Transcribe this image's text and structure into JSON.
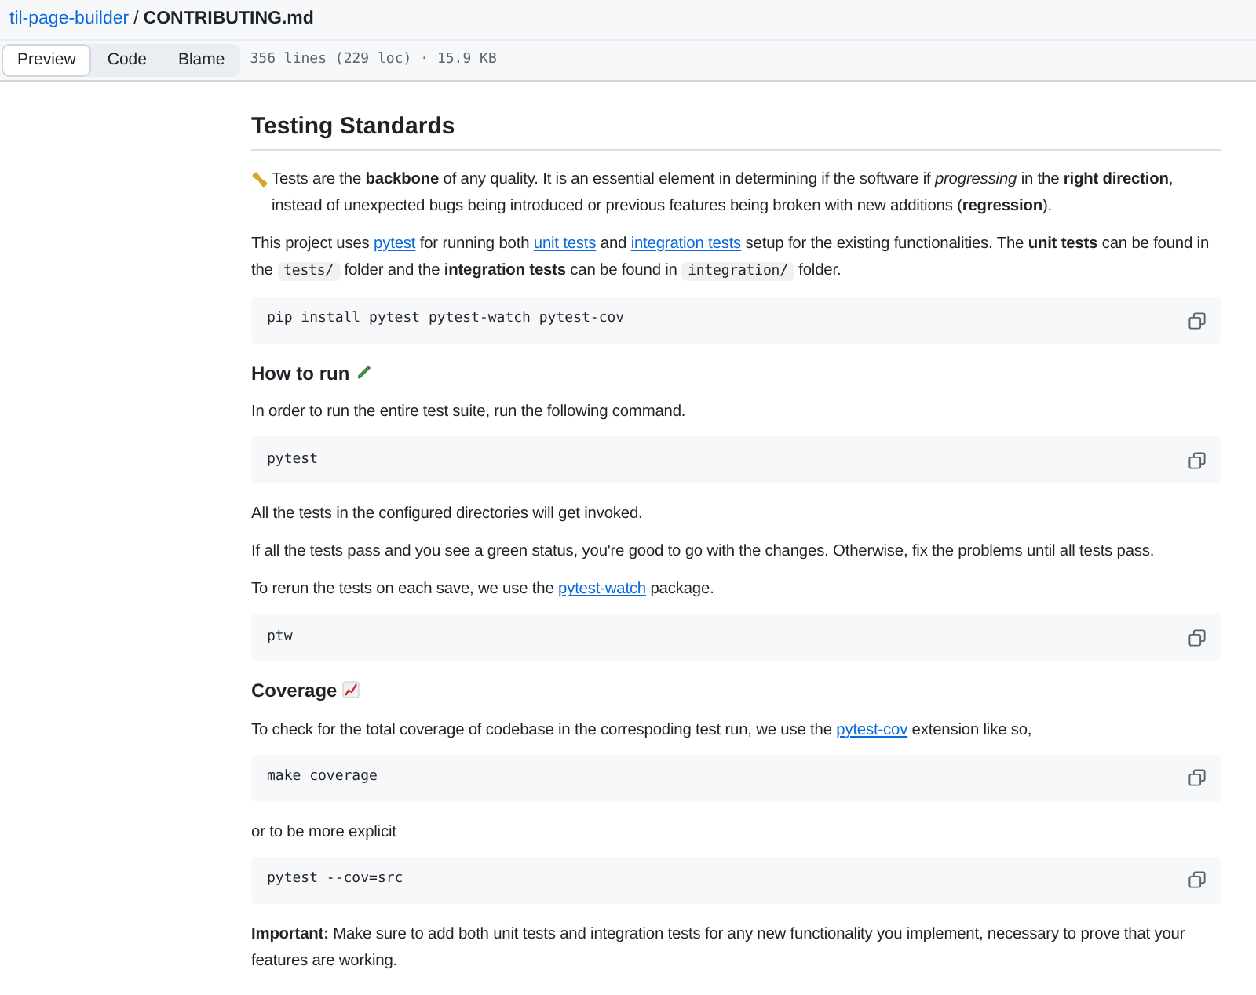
{
  "breadcrumb": {
    "repo": "til-page-builder",
    "separator": "/",
    "file": "CONTRIBUTING.md"
  },
  "view_tabs": [
    {
      "label": "Preview",
      "selected": true
    },
    {
      "label": "Code",
      "selected": false
    },
    {
      "label": "Blame",
      "selected": false
    }
  ],
  "file_info": "356 lines (229 loc) · 15.9 KB",
  "content": [
    {
      "kind": "h2",
      "parts": [
        {
          "kind": "text",
          "text": "Testing Standards"
        }
      ]
    },
    {
      "kind": "p",
      "parts": [
        {
          "kind": "icon"
        },
        {
          "kind": "text",
          "text": " Tests are the **backbone** of any quality. It is an essential element in determining if the software if *progressing* in the **right direction**, instead of unexpected bugs being introduced or previous features being broken with new additions (**regression**)."
        }
      ]
    },
    {
      "kind": "p",
      "parts": [
        {
          "kind": "text",
          "text": "This project uses "
        },
        {
          "kind": "link",
          "text": "pytest"
        },
        {
          "kind": "text",
          "text": " for running both "
        },
        {
          "kind": "link",
          "text": "unit tests"
        },
        {
          "kind": "text",
          "text": " and "
        },
        {
          "kind": "link",
          "text": "integration tests"
        },
        {
          "kind": "text",
          "text": " setup for the existing functionalities. The **unit tests** can be found in the "
        },
        {
          "kind": "code",
          "text": "tests/"
        },
        {
          "kind": "text",
          "text": " folder and the **integration tests** can be found in "
        },
        {
          "kind": "code",
          "text": "integration/"
        },
        {
          "kind": "text",
          "text": " folder."
        }
      ]
    },
    {
      "kind": "code",
      "text": "pip install pytest pytest-watch pytest-cov"
    },
    {
      "kind": "h3",
      "parts": [
        {
          "kind": "text",
          "text": "How to run "
        },
        {
          "kind": "icon"
        }
      ]
    },
    {
      "kind": "p",
      "parts": [
        {
          "kind": "text",
          "text": "In order to run the entire test suite, run the following command."
        }
      ]
    },
    {
      "kind": "code",
      "text": "pytest"
    },
    {
      "kind": "p",
      "parts": [
        {
          "kind": "text",
          "text": "All the tests in the configured directories will get invoked."
        }
      ]
    },
    {
      "kind": "p",
      "parts": [
        {
          "kind": "text",
          "text": "If all the tests pass and you see a green status, you're good to go with the changes. Otherwise, fix the problems until all tests pass."
        }
      ]
    },
    {
      "kind": "p",
      "parts": [
        {
          "kind": "text",
          "text": "To rerun the tests on each save, we use the "
        },
        {
          "kind": "link",
          "text": "pytest-watch"
        },
        {
          "kind": "text",
          "text": " package."
        }
      ]
    },
    {
      "kind": "code",
      "text": "ptw"
    },
    {
      "kind": "h3",
      "parts": [
        {
          "kind": "text",
          "text": "Coverage "
        },
        {
          "kind": "icon"
        }
      ]
    },
    {
      "kind": "p",
      "parts": [
        {
          "kind": "text",
          "text": "To check for the total coverage of codebase in the correspoding test run, we use the "
        },
        {
          "kind": "link",
          "text": "pytest-cov"
        },
        {
          "kind": "text",
          "text": " extension like so,"
        }
      ]
    },
    {
      "kind": "code",
      "text": "make coverage"
    },
    {
      "kind": "p",
      "parts": [
        {
          "kind": "text",
          "text": "or to be more explicit"
        }
      ]
    },
    {
      "kind": "code",
      "text": "pytest --cov=src"
    },
    {
      "kind": "p",
      "parts": [
        {
          "kind": "text",
          "text": "**Important:** Make sure to add both unit tests and integration tests for any new functionality you implement, necessary to prove that your features are working."
        }
      ]
    }
  ]
}
